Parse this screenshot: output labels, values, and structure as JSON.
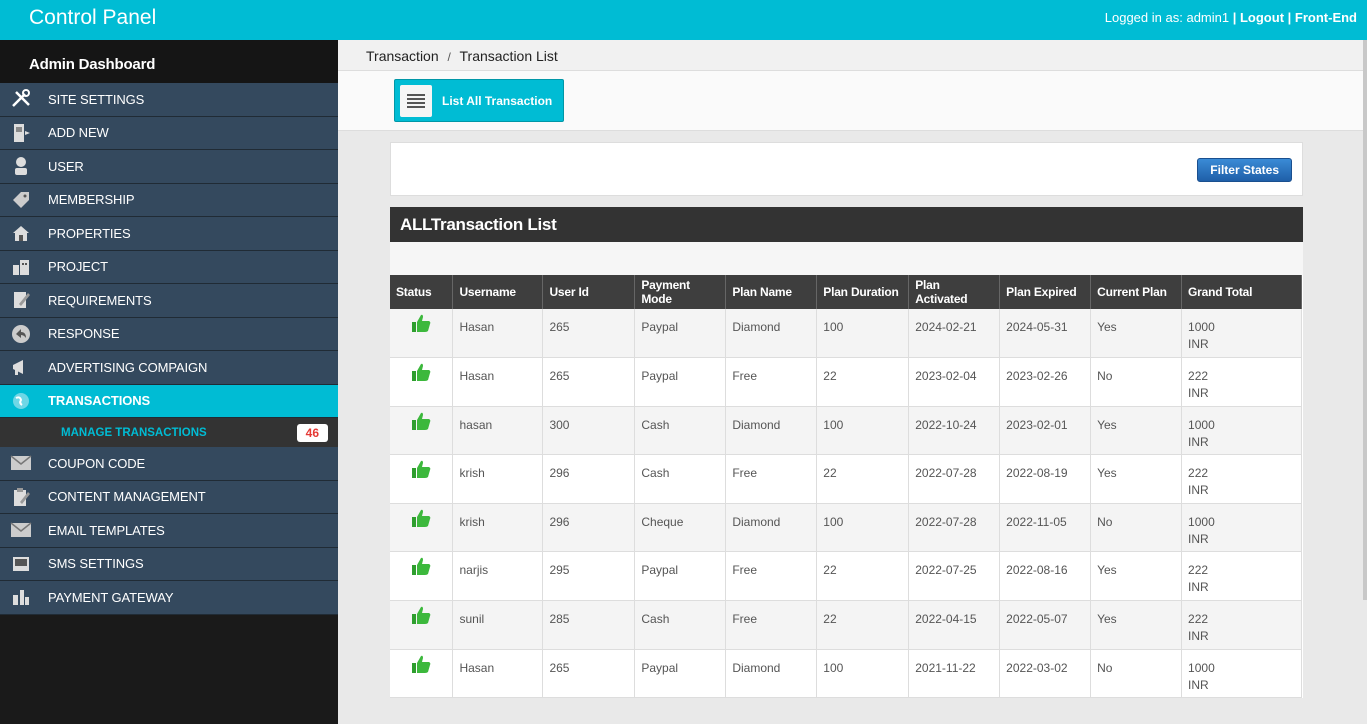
{
  "header": {
    "brand": "Control Panel",
    "logged_in_prefix": "Logged in as:",
    "username": "admin1",
    "logout": "Logout",
    "frontend": "Front-End"
  },
  "sidebar": {
    "title": "Admin Dashboard",
    "items": [
      {
        "label": "SITE SETTINGS",
        "icon": "tools-icon"
      },
      {
        "label": "ADD NEW",
        "icon": "door-icon"
      },
      {
        "label": "USER",
        "icon": "user-icon"
      },
      {
        "label": "MEMBERSHIP",
        "icon": "tag-icon"
      },
      {
        "label": "PROPERTIES",
        "icon": "house-icon"
      },
      {
        "label": "PROJECT",
        "icon": "building-icon"
      },
      {
        "label": "REQUIREMENTS",
        "icon": "document-pen-icon"
      },
      {
        "label": "RESPONSE",
        "icon": "reply-icon"
      },
      {
        "label": "ADVERTISING COMPAIGN",
        "icon": "megaphone-icon"
      },
      {
        "label": "TRANSACTIONS",
        "icon": "globe-icon"
      }
    ],
    "submenu": {
      "label": "MANAGE TRANSACTIONS",
      "count": "46"
    },
    "items_after": [
      {
        "label": "COUPON CODE",
        "icon": "envelope-icon"
      },
      {
        "label": "CONTENT MANAGEMENT",
        "icon": "clipboard-icon"
      },
      {
        "label": "EMAIL TEMPLATES",
        "icon": "mail-icon"
      },
      {
        "label": "SMS SETTINGS",
        "icon": "phone-icon"
      },
      {
        "label": "PAYMENT GATEWAY",
        "icon": "bank-icon"
      }
    ]
  },
  "breadcrumb": {
    "root": "Transaction",
    "separator": "/",
    "current": "Transaction List"
  },
  "toolbar": {
    "list_all": "List All Transaction"
  },
  "filter": {
    "button": "Filter States"
  },
  "table": {
    "title": "ALLTransaction List",
    "columns": [
      "Status",
      "Username",
      "User Id",
      "Payment Mode",
      "Plan Name",
      "Plan Duration",
      "Plan Activated",
      "Plan Expired",
      "Current Plan",
      "Grand Total"
    ],
    "rows": [
      [
        "Hasan",
        "265",
        "Paypal",
        "Diamond",
        "100",
        "2024-02-21",
        "2024-05-31",
        "Yes",
        "1000",
        "INR"
      ],
      [
        "Hasan",
        "265",
        "Paypal",
        "Free",
        "22",
        "2023-02-04",
        "2023-02-26",
        "No",
        "222",
        "INR"
      ],
      [
        "hasan",
        "300",
        "Cash",
        "Diamond",
        "100",
        "2022-10-24",
        "2023-02-01",
        "Yes",
        "1000",
        "INR"
      ],
      [
        "krish",
        "296",
        "Cash",
        "Free",
        "22",
        "2022-07-28",
        "2022-08-19",
        "Yes",
        "222",
        "INR"
      ],
      [
        "krish",
        "296",
        "Cheque",
        "Diamond",
        "100",
        "2022-07-28",
        "2022-11-05",
        "No",
        "1000",
        "INR"
      ],
      [
        "narjis",
        "295",
        "Paypal",
        "Free",
        "22",
        "2022-07-25",
        "2022-08-16",
        "Yes",
        "222",
        "INR"
      ],
      [
        "sunil",
        "285",
        "Cash",
        "Free",
        "22",
        "2022-04-15",
        "2022-05-07",
        "Yes",
        "222",
        "INR"
      ],
      [
        "Hasan",
        "265",
        "Paypal",
        "Diamond",
        "100",
        "2021-11-22",
        "2022-03-02",
        "No",
        "1000",
        "INR"
      ]
    ]
  }
}
